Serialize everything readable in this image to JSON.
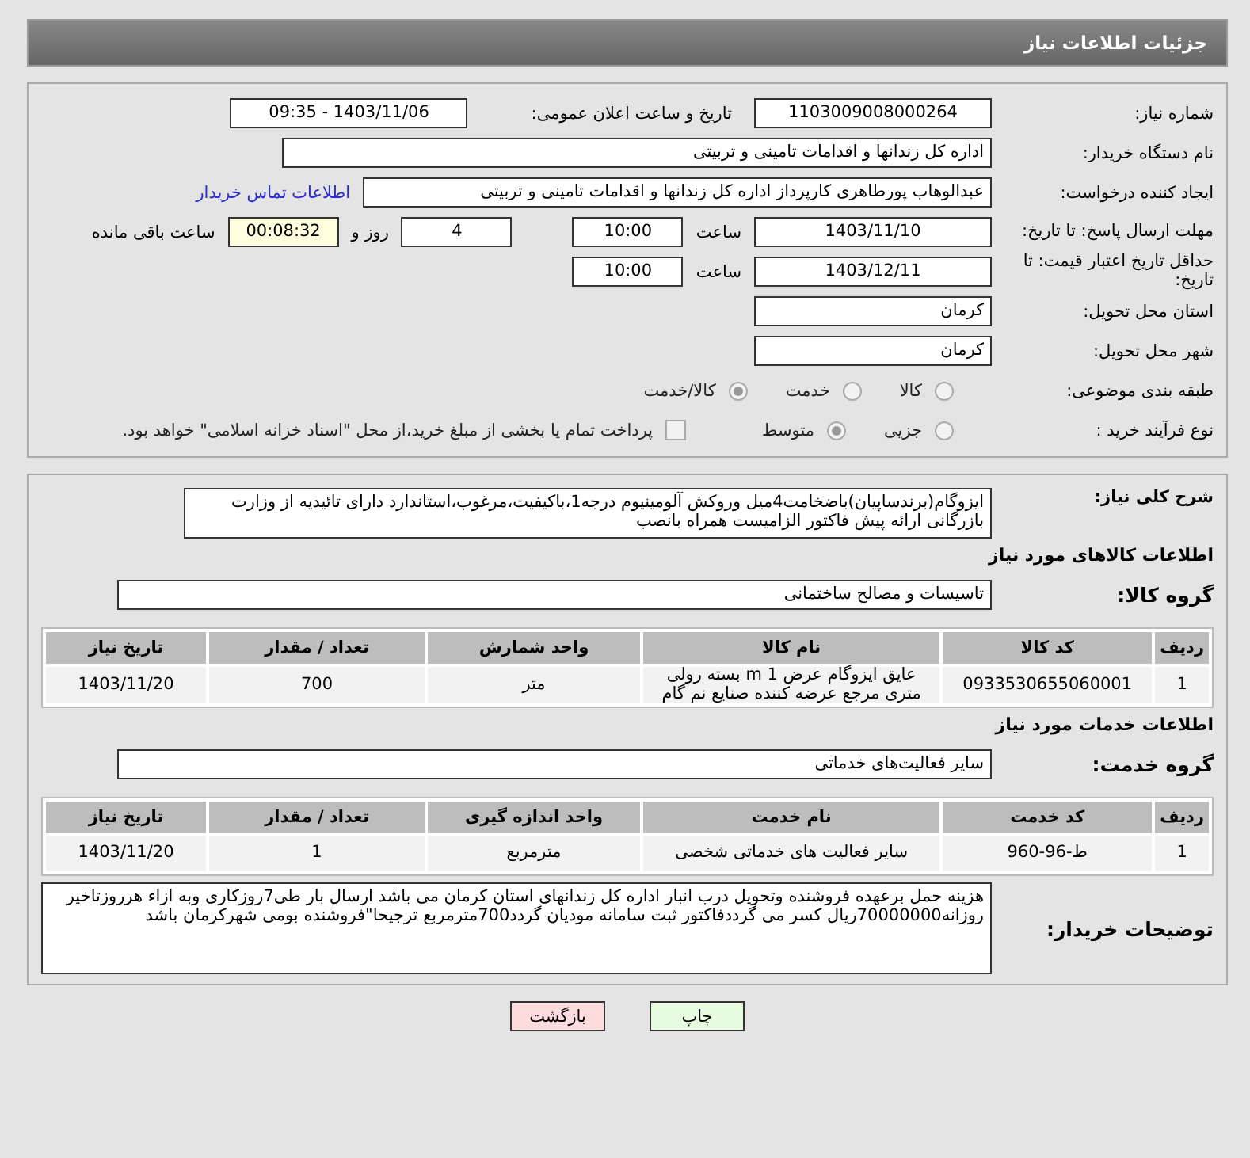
{
  "header": {
    "title": "جزئیات اطلاعات نیاز"
  },
  "need_number": {
    "label": "شماره نیاز:",
    "value": "1103009008000264"
  },
  "announce": {
    "label": "تاریخ و ساعت اعلان عمومی:",
    "value": "1403/11/06 - 09:35"
  },
  "buyer": {
    "label": "نام دستگاه خریدار:",
    "value": "اداره کل زندانها و اقدامات تامینی و تربیتی"
  },
  "creator": {
    "label": "ایجاد کننده درخواست:",
    "value": "عبدالوهاب پورطاهری کارپرداز اداره کل زندانها و اقدامات تامینی و تربیتی",
    "link": "اطلاعات تماس خریدار"
  },
  "deadline": {
    "label": "مهلت ارسال پاسخ: تا تاریخ:",
    "date": "1403/11/10",
    "time_label": "ساعت",
    "time": "10:00",
    "days": "4",
    "days_label": "روز و",
    "remaining": "00:08:32",
    "remaining_label": "ساعت باقی مانده"
  },
  "validity": {
    "label": "حداقل تاریخ اعتبار قیمت: تا تاریخ:",
    "date": "1403/12/11",
    "time_label": "ساعت",
    "time": "10:00"
  },
  "province": {
    "label": "استان محل تحویل:",
    "value": "کرمان"
  },
  "city": {
    "label": "شهر محل تحویل:",
    "value": "کرمان"
  },
  "category": {
    "label": "طبقه بندی موضوعی:",
    "options": [
      {
        "label": "کالا",
        "selected": false
      },
      {
        "label": "خدمت",
        "selected": false
      },
      {
        "label": "کالا/خدمت",
        "selected": true
      }
    ]
  },
  "process": {
    "label": "نوع فرآیند خرید :",
    "options": [
      {
        "label": "جزیی",
        "selected": false
      },
      {
        "label": "متوسط",
        "selected": true
      }
    ],
    "payment": {
      "label": "پرداخت تمام یا بخشی از مبلغ خرید،از محل \"اسناد خزانه اسلامی\" خواهد بود.",
      "checked": false
    }
  },
  "description": {
    "label": "شرح کلی نیاز:",
    "value": "ایزوگام(برندساپیان)باضخامت4میل وروکش آلومینیوم درجه1،باکیفیت،مرغوب،استاندارد دارای تائیدیه از وزارت بازرگانی ارائه پیش فاکتور الزامیست همراه بانصب"
  },
  "goods": {
    "title": "اطلاعات کالاهای مورد نیاز",
    "group_label": "گروه کالا:",
    "group": "تاسیسات و مصالح ساختمانی",
    "columns": [
      "ردیف",
      "کد کالا",
      "نام کالا",
      "واحد شمارش",
      "تعداد / مقدار",
      "تاریخ نیاز"
    ],
    "rows": [
      [
        "1",
        "0933530655060001",
        "عایق ایزوگام عرض 1 m بسته رولی متری مرجع عرضه کننده صنایع نم گام",
        "متر",
        "700",
        "1403/11/20"
      ]
    ]
  },
  "services": {
    "title": "اطلاعات خدمات مورد نیاز",
    "group_label": "گروه خدمت:",
    "group": "سایر فعالیت‌های خدماتی",
    "columns": [
      "ردیف",
      "کد خدمت",
      "نام خدمت",
      "واحد اندازه گیری",
      "تعداد / مقدار",
      "تاریخ نیاز"
    ],
    "rows": [
      [
        "1",
        "ط-96-960",
        "سایر فعالیت های خدماتی شخصی",
        "مترمربع",
        "1",
        "1403/11/20"
      ]
    ]
  },
  "notes": {
    "label": "توضیحات خریدار:",
    "value": "هزینه حمل برعهده فروشنده وتحویل درب انبار اداره کل زندانهای استان کرمان می باشد ارسال بار طی7روزکاری وبه ازاء هرروزتاخیر روزانه70000000ریال کسر می گرددفاکتور ثبت سامانه مودیان گردد700مترمربع ترجیحا\"فروشنده بومی شهرکرمان باشد"
  },
  "buttons": [
    {
      "label": "چاپ",
      "kind": "print"
    },
    {
      "label": "بازگشت",
      "kind": "back"
    }
  ]
}
